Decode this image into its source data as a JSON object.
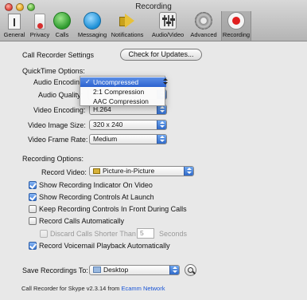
{
  "window": {
    "title": "Recording"
  },
  "toolbar": {
    "items": [
      {
        "label": "General",
        "icon": "general-icon"
      },
      {
        "label": "Privacy",
        "icon": "privacy-icon"
      },
      {
        "label": "Calls",
        "icon": "calls-icon"
      },
      {
        "label": "Messaging",
        "icon": "messaging-icon"
      },
      {
        "label": "Notifications",
        "icon": "notifications-icon"
      },
      {
        "label": "Audio/Video",
        "icon": "audio-video-icon"
      },
      {
        "label": "Advanced",
        "icon": "gear-icon"
      },
      {
        "label": "Recording",
        "icon": "record-icon",
        "selected": true
      }
    ]
  },
  "settings": {
    "call_recorder_label": "Call Recorder Settings",
    "check_updates_label": "Check for Updates...",
    "quicktime_label": "QuickTime Options:",
    "audio_encoding_label": "Audio Encoding:",
    "audio_quality_label": "Audio Quality:",
    "video_encoding_label": "Video Encoding:",
    "video_encoding_value": "H.264",
    "video_image_size_label": "Video Image Size:",
    "video_image_size_value": "320 x 240",
    "video_frame_rate_label": "Video Frame Rate:",
    "video_frame_rate_value": "Medium",
    "recording_options_label": "Recording Options:",
    "record_video_label": "Record Video:",
    "record_video_value": "Picture-in-Picture",
    "checkboxes": [
      {
        "label": "Show Recording Indicator On Video",
        "checked": true
      },
      {
        "label": "Show Recording Controls At Launch",
        "checked": true
      },
      {
        "label": "Keep Recording Controls In Front During Calls",
        "checked": false
      },
      {
        "label": "Record Calls Automatically",
        "checked": false
      }
    ],
    "discard_label": "Discard Calls Shorter Than",
    "discard_value": "5",
    "discard_unit": "Seconds",
    "voicemail_label": "Record Voicemail Playback Automatically",
    "save_recordings_label": "Save Recordings To:",
    "save_recordings_value": "Desktop"
  },
  "audio_encoding_menu": {
    "options": [
      "Uncompressed",
      "2:1 Compression",
      "AAC Compression"
    ],
    "selected": "Uncompressed"
  },
  "footer": {
    "text": "Call Recorder for Skype v2.3.14 from ",
    "link": "Ecamm Network"
  },
  "colors": {
    "accent": "#2c62cf",
    "link": "#1a55d6",
    "record": "#e01e1e"
  }
}
